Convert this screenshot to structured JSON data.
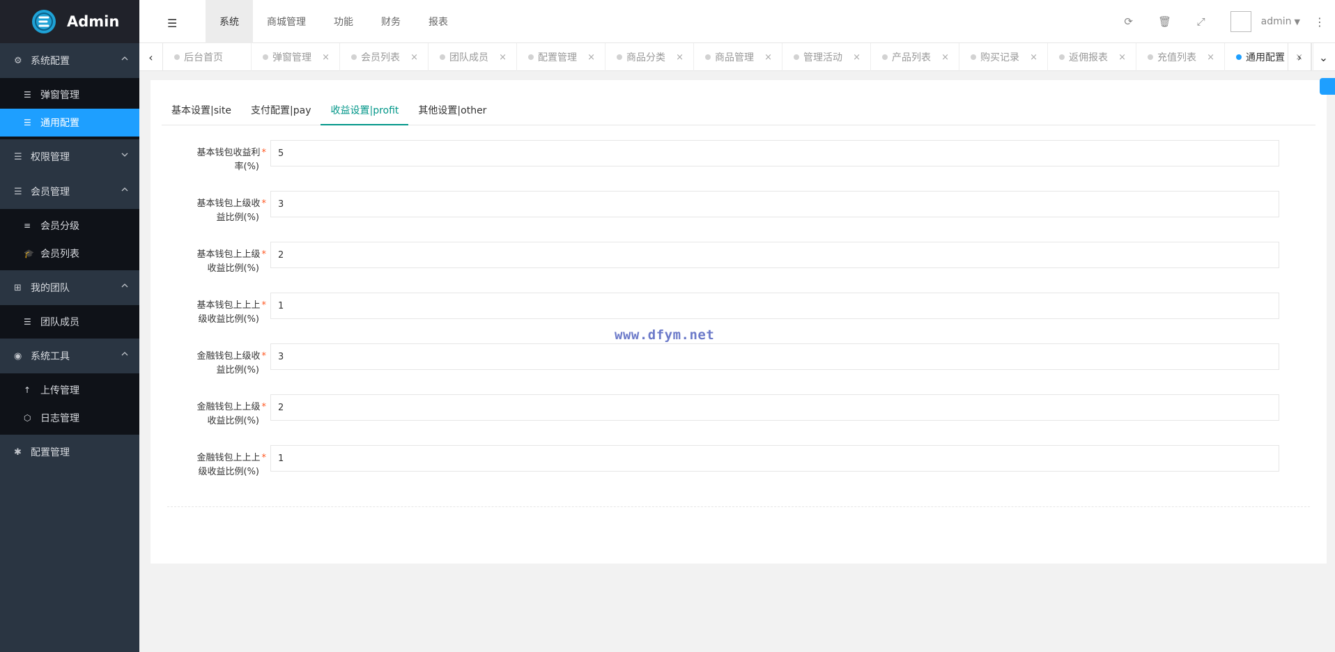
{
  "sidebar": {
    "logo_text": "Admin",
    "groups": [
      {
        "label": "系统配置",
        "icon": "gears-icon",
        "expanded": true,
        "items": [
          {
            "label": "弹窗管理",
            "icon": "list-icon"
          },
          {
            "label": "通用配置",
            "icon": "list-icon",
            "active": true
          }
        ]
      },
      {
        "label": "权限管理",
        "icon": "list-icon",
        "expanded": false,
        "items": []
      },
      {
        "label": "会员管理",
        "icon": "list-icon",
        "expanded": true,
        "items": [
          {
            "label": "会员分级",
            "icon": "align-icon"
          },
          {
            "label": "会员列表",
            "icon": "graduation-cap-icon"
          }
        ]
      },
      {
        "label": "我的团队",
        "icon": "sitemap-icon",
        "expanded": true,
        "items": [
          {
            "label": "团队成员",
            "icon": "list-icon"
          }
        ]
      },
      {
        "label": "系统工具",
        "icon": "compass-icon",
        "expanded": true,
        "items": [
          {
            "label": "上传管理",
            "icon": "arrow-up-icon"
          },
          {
            "label": "日志管理",
            "icon": "log-icon"
          }
        ]
      },
      {
        "label": "配置管理",
        "icon": "asterisk-icon",
        "expanded": false,
        "items": []
      }
    ]
  },
  "header": {
    "nav": [
      "系统",
      "商城管理",
      "功能",
      "财务",
      "报表"
    ],
    "active_nav": "系统",
    "user": "admin"
  },
  "tabs": [
    {
      "label": "后台首页",
      "closable": false
    },
    {
      "label": "弹窗管理",
      "closable": true
    },
    {
      "label": "会员列表",
      "closable": true
    },
    {
      "label": "团队成员",
      "closable": true
    },
    {
      "label": "配置管理",
      "closable": true
    },
    {
      "label": "商品分类",
      "closable": true
    },
    {
      "label": "商品管理",
      "closable": true
    },
    {
      "label": "管理活动",
      "closable": true
    },
    {
      "label": "产品列表",
      "closable": true
    },
    {
      "label": "购买记录",
      "closable": true
    },
    {
      "label": "返佣报表",
      "closable": true
    },
    {
      "label": "充值列表",
      "closable": true
    },
    {
      "label": "通用配置",
      "closable": true,
      "active": true
    }
  ],
  "subtabs": [
    "基本设置|site",
    "支付配置|pay",
    "收益设置|profit",
    "其他设置|other"
  ],
  "active_subtab": "收益设置|profit",
  "form": {
    "fields": [
      {
        "label_line1": "基本钱包收益利",
        "label_line2": "率(%)",
        "value": "5"
      },
      {
        "label_line1": "基本钱包上级收",
        "label_line2": "益比例(%)",
        "value": "3"
      },
      {
        "label_line1": "基本钱包上上级",
        "label_line2": "收益比例(%)",
        "value": "2"
      },
      {
        "label_line1": "基本钱包上上上",
        "label_line2": "级收益比例(%)",
        "value": "1"
      },
      {
        "label_line1": "金融钱包上级收",
        "label_line2": "益比例(%)",
        "value": "3"
      },
      {
        "label_line1": "金融钱包上上级",
        "label_line2": "收益比例(%)",
        "value": "2"
      },
      {
        "label_line1": "金融钱包上上上",
        "label_line2": "级收益比例(%)",
        "value": "1"
      }
    ]
  },
  "watermark": "www.dfym.net",
  "colors": {
    "sidebar_bg": "#2a3542",
    "active_blue": "#1e9fff",
    "tab_green": "#009688",
    "required": "#ff5722"
  }
}
